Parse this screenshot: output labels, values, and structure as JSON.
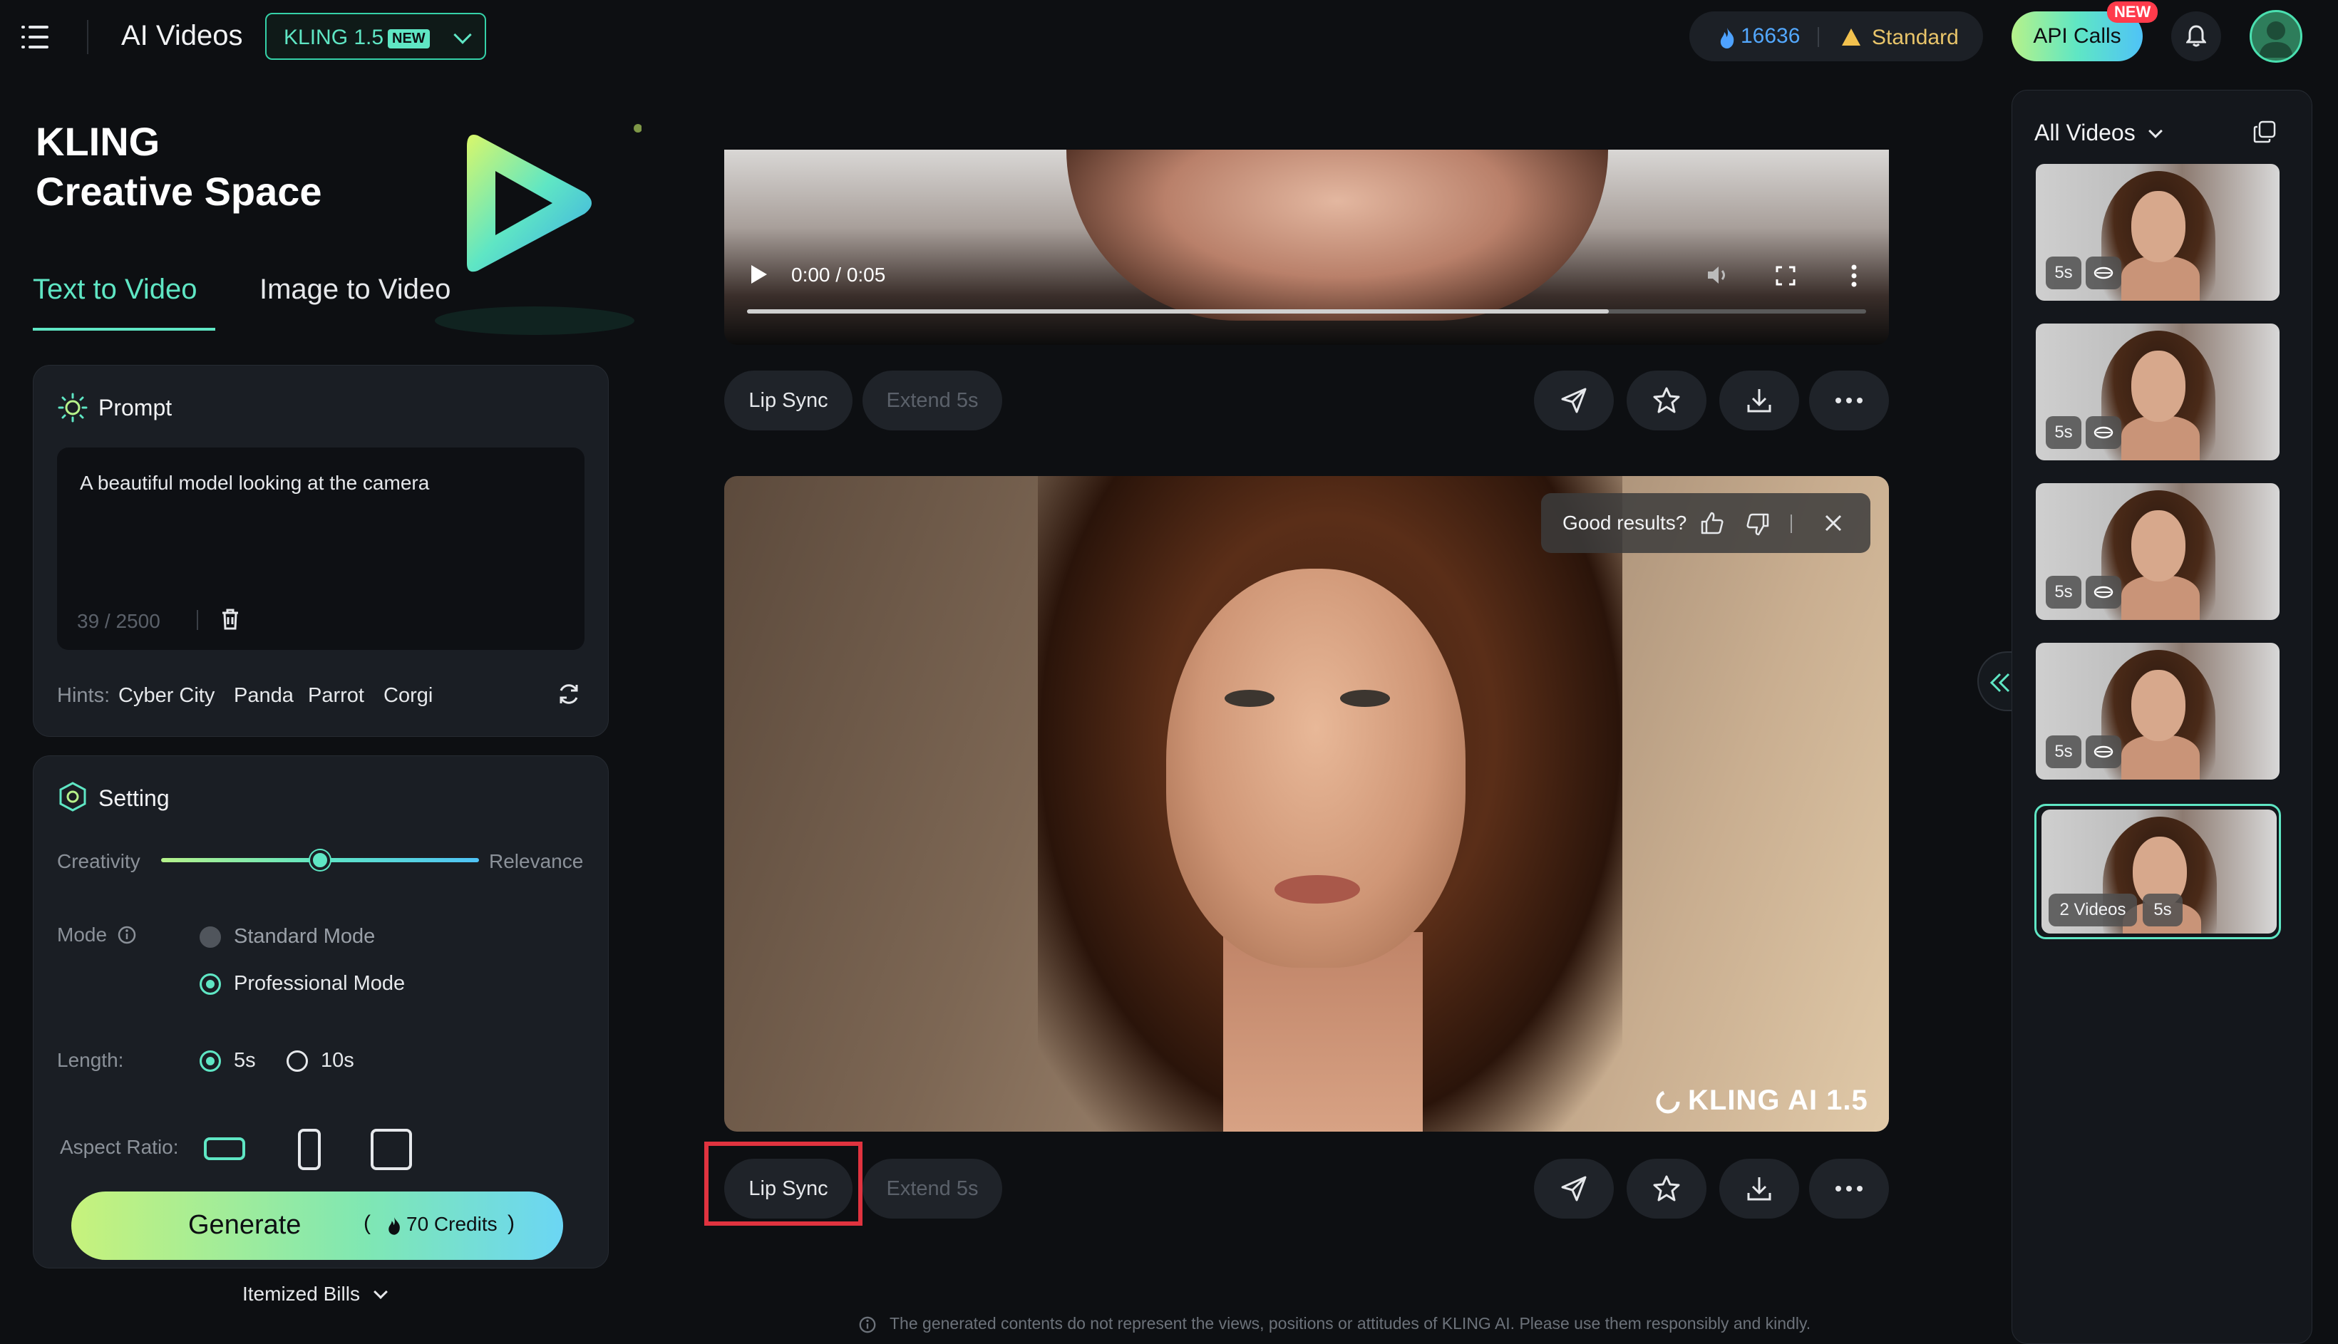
{
  "header": {
    "app_title": "AI Videos",
    "model": "KLING 1.5",
    "model_badge": "NEW",
    "credits": "16636",
    "plan": "Standard",
    "api_button": "API Calls",
    "api_badge": "NEW"
  },
  "hero": {
    "title_line1": "KLING",
    "title_line2": "Creative Space"
  },
  "tabs": [
    {
      "label": "Text to Video",
      "active": true
    },
    {
      "label": "Image to Video",
      "active": false
    }
  ],
  "prompt": {
    "title": "Prompt",
    "value": "A beautiful model looking at the camera",
    "count": "39 / 2500",
    "hints_label": "Hints:",
    "hints": [
      "Cyber City",
      "Panda",
      "Parrot",
      "Corgi"
    ]
  },
  "setting": {
    "title": "Setting",
    "creativity_label": "Creativity",
    "relevance_label": "Relevance",
    "slider_fraction": 0.5,
    "mode_label": "Mode",
    "modes": [
      "Standard Mode",
      "Professional Mode"
    ],
    "selected_mode": "Professional Mode",
    "length_label": "Length:",
    "lengths": [
      "5s",
      "10s"
    ],
    "selected_length": "5s",
    "aspect_label": "Aspect Ratio:"
  },
  "generate": {
    "label": "Generate",
    "credits": "70 Credits",
    "itemized": "Itemized Bills"
  },
  "player": {
    "time": "0:00 / 0:05",
    "progress_fraction": 0.77
  },
  "video_actions": {
    "lip_sync": "Lip Sync",
    "extend": "Extend 5s"
  },
  "feedback": {
    "question": "Good results?"
  },
  "watermark": "KLING AI 1.5",
  "disclaimer": "The generated contents do not represent the views, positions or attitudes of KLING AI. Please use them responsibly and kindly.",
  "history": {
    "title": "All Videos",
    "items": [
      {
        "duration": "5s"
      },
      {
        "duration": "5s"
      },
      {
        "duration": "5s"
      },
      {
        "duration": "5s"
      },
      {
        "duration": "5s",
        "count": "2 Videos",
        "selected": true
      }
    ]
  },
  "colors": {
    "accent": "#5fe6c4",
    "background": "#0d0f12",
    "panel": "#1a1e24",
    "highlight": "#e0333f"
  }
}
